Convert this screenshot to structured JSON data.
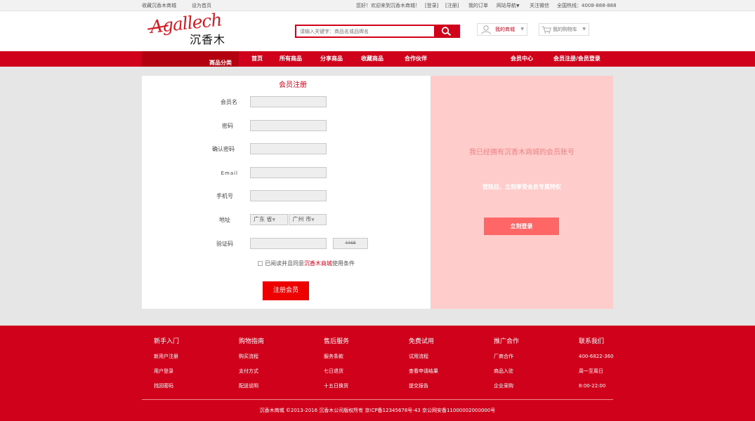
{
  "topbar": {
    "bookmark": "收藏沉香木商城",
    "homepage": "设为首页",
    "welcome": "您好！欢迎来到沉香木商城！",
    "login": "[登录]",
    "register": "[注册]",
    "orders": "我的订单",
    "site_nav": "网站导航",
    "wechat": "关注微信",
    "hotline": "全国热线：4008-888-888"
  },
  "logo": {
    "script_text": "Agallech",
    "cn_text": "沉香木"
  },
  "search": {
    "placeholder": "请输入关键字：商品名或品牌名",
    "icon": "search-icon"
  },
  "header": {
    "my_store": "我的商城",
    "my_cart": "我的购物车"
  },
  "nav": {
    "category": "商品分类",
    "items": [
      "首页",
      "所有商品",
      "分享商品",
      "收藏商品",
      "合作伙伴"
    ],
    "member_center": "会员中心",
    "register_login": "会员注册/会员登录"
  },
  "register": {
    "title": "会员注册",
    "fields": [
      {
        "label": "会员名",
        "value": ""
      },
      {
        "label": "密码",
        "value": ""
      },
      {
        "label": "确认密码",
        "value": ""
      },
      {
        "label": "Email",
        "value": ""
      },
      {
        "label": "手机号",
        "value": ""
      }
    ],
    "address_label": "地址",
    "province": "广东 省",
    "city": "广州 市",
    "captcha_label": "验证码",
    "captcha_code": "4468",
    "agree_prefix": "已阅读并且同意",
    "agree_link": "沉香木商城",
    "agree_suffix": "使用条件",
    "submit": "注册会员"
  },
  "login_panel": {
    "title": "我已经拥有沉香木商城的会员账号",
    "subtitle": "登陆后，立刻享受会员专属特权",
    "button": "立刻登录"
  },
  "footer": {
    "columns": [
      {
        "heading": "新手入门",
        "links": [
          "新用户注册",
          "用户登录",
          "找回密码"
        ]
      },
      {
        "heading": "购物指南",
        "links": [
          "购买流程",
          "支付方式",
          "配送说明"
        ]
      },
      {
        "heading": "售后服务",
        "links": [
          "服务条款",
          "七日退货",
          "十五日换货"
        ]
      },
      {
        "heading": "免费试用",
        "links": [
          "试用流程",
          "查看申请结果",
          "提交报告"
        ]
      },
      {
        "heading": "推广合作",
        "links": [
          "厂商合作",
          "商品入驻",
          "企业采购"
        ]
      },
      {
        "heading": "联系我们",
        "links": [
          "400-6822-360",
          "周一至周日",
          "8:00-22:00"
        ]
      }
    ],
    "copyright": "沉香木商城 ©2013-2016 沉香木公司版权所有 京ICP备12345678号-43 京公网安备11000002000000号"
  },
  "colors": {
    "brand_red": "#d0021b",
    "login_panel_bg": "#ffcccc",
    "login_button": "#ff6666"
  }
}
